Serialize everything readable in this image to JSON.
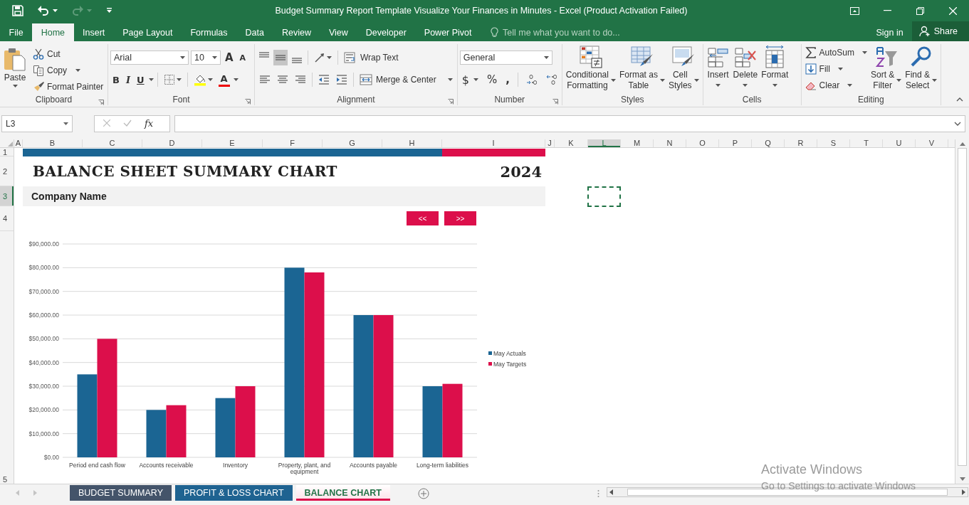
{
  "window": {
    "title": "Budget Summary Report Template Visualize Your Finances in Minutes - Excel (Product Activation Failed)"
  },
  "quick_access": [
    {
      "kind": "save",
      "disabled": false
    },
    {
      "kind": "undo",
      "disabled": false
    },
    {
      "kind": "redo",
      "disabled": true
    },
    {
      "kind": "customize",
      "disabled": false
    }
  ],
  "ribbon_tabs": [
    {
      "label": "File",
      "selected": false
    },
    {
      "label": "Home",
      "selected": true
    },
    {
      "label": "Insert",
      "selected": false
    },
    {
      "label": "Page Layout",
      "selected": false
    },
    {
      "label": "Formulas",
      "selected": false
    },
    {
      "label": "Data",
      "selected": false
    },
    {
      "label": "Review",
      "selected": false
    },
    {
      "label": "View",
      "selected": false
    },
    {
      "label": "Developer",
      "selected": false
    },
    {
      "label": "Power Pivot",
      "selected": false
    }
  ],
  "tell_me": {
    "placeholder": "Tell me what you want to do..."
  },
  "account": {
    "sign_in": "Sign in",
    "share": "Share"
  },
  "ribbon": {
    "groups": [
      {
        "kind": "clipboard",
        "label": "Clipboard",
        "paste": "Paste",
        "items": [
          {
            "label": "Cut",
            "menu": false
          },
          {
            "label": "Copy",
            "menu": true
          },
          {
            "label": "Format Painter",
            "menu": false
          }
        ]
      },
      {
        "kind": "font",
        "label": "Font",
        "font": "Arial",
        "size": "10",
        "grow": "A",
        "shrink": "A",
        "bold": "B",
        "italic": "I",
        "underline": "U",
        "font_color": "A"
      },
      {
        "kind": "alignment",
        "label": "Alignment",
        "vertical_align": [
          {
            "selected": false
          },
          {
            "selected": true
          },
          {
            "selected": false
          }
        ],
        "wrap_text": "Wrap Text",
        "merge": "Merge & Center"
      },
      {
        "kind": "number",
        "label": "Number",
        "format": "General",
        "currency": "$",
        "percent": "%",
        "comma": ","
      },
      {
        "kind": "styles",
        "label": "Styles",
        "items": [
          {
            "label": "Conditional\nFormatting",
            "menu": true
          },
          {
            "label": "Format as\nTable",
            "menu": true
          },
          {
            "label": "Cell\nStyles",
            "menu": true
          }
        ]
      },
      {
        "kind": "cells",
        "label": "Cells",
        "items": [
          {
            "label": "Insert",
            "menu": true
          },
          {
            "label": "Delete",
            "menu": true
          },
          {
            "label": "Format",
            "menu": true
          }
        ]
      },
      {
        "kind": "editing",
        "label": "Editing",
        "small": [
          {
            "label": "AutoSum",
            "menu": true
          },
          {
            "label": "Fill",
            "menu": true
          },
          {
            "label": "Clear",
            "menu": true
          }
        ],
        "items": [
          {
            "label": "Sort &\nFilter",
            "menu": true
          },
          {
            "label": "Find &\nSelect",
            "menu": true
          }
        ]
      }
    ]
  },
  "formula_bar": {
    "name_box": "L3",
    "function_label": "fx"
  },
  "columns": [
    {
      "label": "A",
      "selected": false
    },
    {
      "label": "B",
      "selected": false
    },
    {
      "label": "C",
      "selected": false
    },
    {
      "label": "D",
      "selected": false
    },
    {
      "label": "E",
      "selected": false
    },
    {
      "label": "F",
      "selected": false
    },
    {
      "label": "G",
      "selected": false
    },
    {
      "label": "H",
      "selected": false
    },
    {
      "label": "I",
      "selected": false
    },
    {
      "label": "J",
      "selected": false
    },
    {
      "label": "K",
      "selected": false
    },
    {
      "label": "L",
      "selected": true
    },
    {
      "label": "M",
      "selected": false
    },
    {
      "label": "N",
      "selected": false
    },
    {
      "label": "O",
      "selected": false
    },
    {
      "label": "P",
      "selected": false
    },
    {
      "label": "Q",
      "selected": false
    },
    {
      "label": "R",
      "selected": false
    },
    {
      "label": "S",
      "selected": false
    },
    {
      "label": "T",
      "selected": false
    },
    {
      "label": "U",
      "selected": false
    },
    {
      "label": "V",
      "selected": false
    }
  ],
  "rows": [
    {
      "label": "1",
      "selected": false
    },
    {
      "label": "2",
      "selected": false
    },
    {
      "label": "3",
      "selected": true
    },
    {
      "label": "4",
      "selected": false
    },
    {
      "label": "5",
      "selected": false
    }
  ],
  "sheet": {
    "title": "BALANCE SHEET SUMMARY CHART",
    "year": "2024",
    "company": "Company Name",
    "nav_buttons": [
      "<<",
      ">>"
    ],
    "chart_data": {
      "type": "bar",
      "categories": [
        "Period end cash flow",
        "Accounts receivable",
        "Inventory",
        "Property, plant, and equipment",
        "Accounts payable",
        "Long-term liabilities"
      ],
      "series": [
        {
          "name": "May Actuals",
          "color": "#1b6593",
          "values": [
            35000,
            20000,
            25000,
            80000,
            60000,
            30000
          ]
        },
        {
          "name": "May Targets",
          "color": "#dc0f4b",
          "values": [
            50000,
            22000,
            30000,
            78000,
            60000,
            31000
          ]
        }
      ],
      "ylim": [
        0,
        90000
      ],
      "grid": true,
      "legend": true,
      "yticks": [
        {
          "value": 0,
          "label": "$0.00"
        },
        {
          "value": 10000,
          "label": "$10,000.00"
        },
        {
          "value": 20000,
          "label": "$20,000.00"
        },
        {
          "value": 30000,
          "label": "$30,000.00"
        },
        {
          "value": 40000,
          "label": "$40,000.00"
        },
        {
          "value": 50000,
          "label": "$50,000.00"
        },
        {
          "value": 60000,
          "label": "$60,000.00"
        },
        {
          "value": 70000,
          "label": "$70,000.00"
        },
        {
          "value": 80000,
          "label": "$80,000.00"
        },
        {
          "value": 90000,
          "label": "$90,000.00"
        }
      ]
    }
  },
  "sheet_tabs": [
    {
      "label": "BUDGET SUMMARY",
      "color": "#44546a",
      "selected": false
    },
    {
      "label": "PROFIT & LOSS CHART",
      "color": "#1f6391",
      "selected": false
    },
    {
      "label": "BALANCE CHART",
      "color": "#dc0f4b",
      "selected": true
    }
  ],
  "activation_notice": {
    "title": "Activate Windows",
    "message": "Go to Settings to activate Windows"
  }
}
